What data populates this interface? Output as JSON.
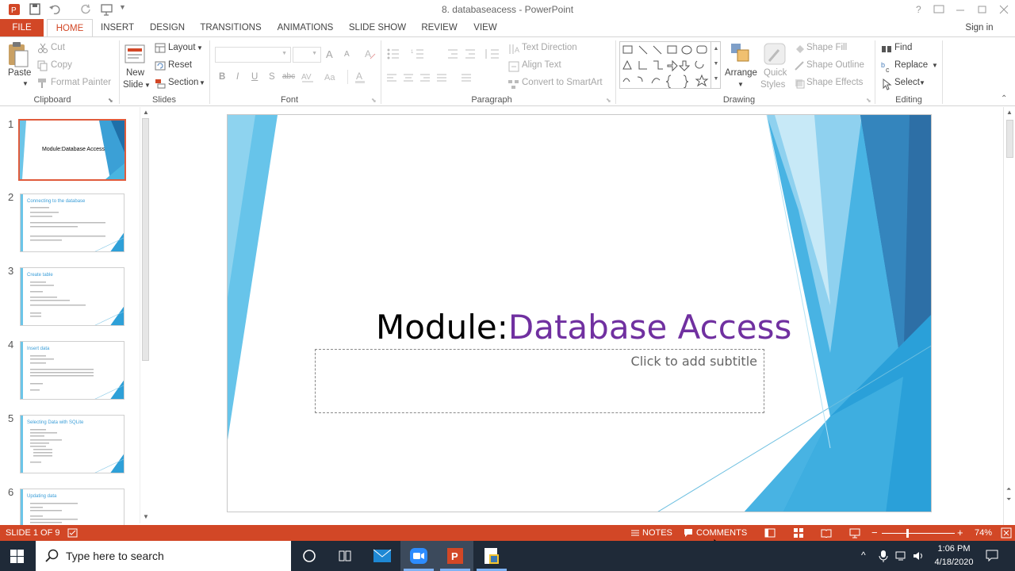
{
  "window": {
    "doc_title": "8. databaseacess - PowerPoint",
    "sign_in": "Sign in"
  },
  "tabs": [
    "FILE",
    "HOME",
    "INSERT",
    "DESIGN",
    "TRANSITIONS",
    "ANIMATIONS",
    "SLIDE SHOW",
    "REVIEW",
    "VIEW"
  ],
  "ribbon": {
    "clipboard": {
      "paste": "Paste",
      "cut": "Cut",
      "copy": "Copy",
      "format_painter": "Format Painter",
      "label": "Clipboard"
    },
    "slides": {
      "new_slide_1": "New",
      "new_slide_2": "Slide",
      "layout": "Layout",
      "reset": "Reset",
      "section": "Section",
      "label": "Slides"
    },
    "font": {
      "label": "Font",
      "bold": "B",
      "italic": "I",
      "underline": "U",
      "shadow": "S",
      "strike": "abc",
      "grow": "A",
      "shrink": "A"
    },
    "paragraph": {
      "text_direction": "Text Direction",
      "align_text": "Align Text",
      "smartart": "Convert to SmartArt",
      "label": "Paragraph"
    },
    "drawing": {
      "arrange": "Arrange",
      "quick_styles_1": "Quick",
      "quick_styles_2": "Styles",
      "shape_fill": "Shape Fill",
      "shape_outline": "Shape Outline",
      "shape_effects": "Shape Effects",
      "label": "Drawing"
    },
    "editing": {
      "find": "Find",
      "replace": "Replace",
      "select": "Select",
      "label": "Editing"
    }
  },
  "thumbnails": [
    {
      "num": "1",
      "title": "Module:Database Access"
    },
    {
      "num": "2",
      "title": "Connecting to the database"
    },
    {
      "num": "3",
      "title": "Create table"
    },
    {
      "num": "4",
      "title": "Insert data"
    },
    {
      "num": "5",
      "title": "Selecting Data with SQLite"
    },
    {
      "num": "6",
      "title": "Updating data"
    }
  ],
  "slide": {
    "title_part1": "Module:",
    "title_part2": "Database Access",
    "subtitle_placeholder": "Click to add subtitle"
  },
  "status": {
    "slide_info": "SLIDE 1 OF 9",
    "notes": "NOTES",
    "comments": "COMMENTS",
    "zoom": "74%"
  },
  "taskbar": {
    "search_placeholder": "Type here to search",
    "time": "1:06 PM",
    "date": "4/18/2020"
  },
  "colors": {
    "accent": "#d24726",
    "title_purple": "#7030a0",
    "taskbar": "#1f2a38"
  }
}
